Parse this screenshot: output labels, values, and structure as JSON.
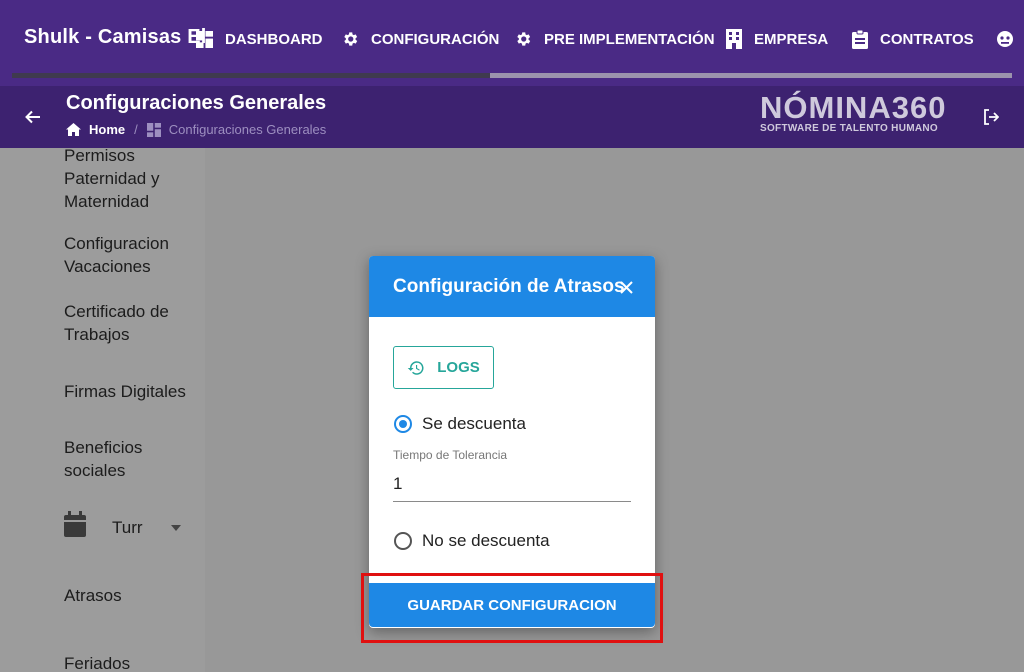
{
  "topbar": {
    "app_title": "Shulk - Camisas El",
    "nav": [
      {
        "label": "DASHBOARD",
        "icon": "dashboard-icon"
      },
      {
        "label": "CONFIGURACIÓN",
        "icon": "gear-icon"
      },
      {
        "label": "PRE IMPLEMENTACIÓN",
        "icon": "gear-icon"
      },
      {
        "label": "EMPRESA",
        "icon": "building-icon"
      },
      {
        "label": "CONTRATOS",
        "icon": "clipboard-icon"
      },
      {
        "label": "",
        "icon": "face-icon"
      }
    ]
  },
  "subheader": {
    "title": "Configuraciones Generales",
    "breadcrumb": {
      "home": "Home",
      "separator": "/",
      "current": "Configuraciones Generales"
    },
    "logo": {
      "main": "NÓMINA360",
      "sub": "SOFTWARE DE TALENTO HUMANO"
    }
  },
  "sidebar": {
    "items": [
      {
        "label": "Permisos Paternidad y Maternidad"
      },
      {
        "label": "Configuracion Vacaciones"
      },
      {
        "label": "Certificado de Trabajos"
      },
      {
        "label": "Firmas Digitales"
      },
      {
        "label": "Beneficios sociales"
      },
      {
        "label": "Turr",
        "icon": "calendar-icon",
        "expandable": true
      },
      {
        "label": "Atrasos"
      },
      {
        "label": "Feriados"
      }
    ]
  },
  "modal": {
    "title": "Configuración de Atrasos",
    "logs_label": "LOGS",
    "option_discount": "Se descuenta",
    "option_no_discount": "No se descuenta",
    "selected_option": "Se descuenta",
    "tolerance_label": "Tiempo de Tolerancia",
    "tolerance_value": "1",
    "save_label": "GUARDAR CONFIGURACION"
  },
  "colors": {
    "topbar": "#4a2a85",
    "subheader": "#3d2270",
    "primary": "#1e88e5",
    "logs": "#26a69a",
    "highlight": "#e01010"
  }
}
